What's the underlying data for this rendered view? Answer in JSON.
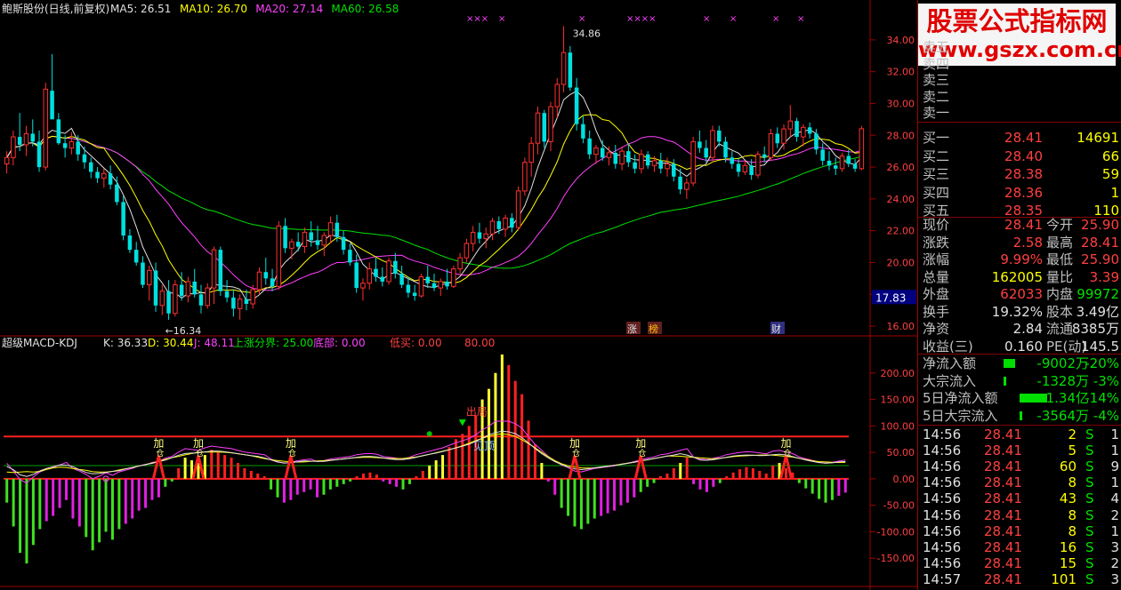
{
  "main_chart": {
    "title": "鲍斯股份(日线,前复权)",
    "legend": [
      {
        "label": "MA5: 26.51",
        "color": "#e0e0e0"
      },
      {
        "label": "MA10: 26.70",
        "color": "#ffff00"
      },
      {
        "label": "MA20: 27.14",
        "color": "#ff40ff"
      },
      {
        "label": "MA60: 26.58",
        "color": "#00e000"
      }
    ],
    "y_ticks": [
      "34.00",
      "32.00",
      "30.00",
      "28.00",
      "26.00",
      "24.00",
      "22.00",
      "20.00",
      "18.00",
      "16.00"
    ],
    "current_price_tag": "17.83",
    "high_label": "34.86",
    "low_label": "←16.34",
    "event_marks": [
      "涨",
      "榜",
      "财"
    ],
    "top_marks": [
      "×××",
      "×",
      "×",
      "××××",
      "×",
      "×",
      "×",
      "×"
    ]
  },
  "chart_data": [
    {
      "type": "candlestick",
      "title": "鲍斯股份(日线,前复权)",
      "ylim": [
        15.5,
        35.5
      ],
      "legend": [
        "MA5: 26.51",
        "MA10: 26.70",
        "MA20: 27.14",
        "MA60: 26.58"
      ],
      "annotations": [
        "34.86",
        "←16.34"
      ],
      "ohlc": [
        [
          26.2,
          27.0,
          25.6,
          26.6
        ],
        [
          26.6,
          28.3,
          26.1,
          27.9
        ],
        [
          27.9,
          29.4,
          27.0,
          27.4
        ],
        [
          27.4,
          28.6,
          26.7,
          28.1
        ],
        [
          28.1,
          29.0,
          27.3,
          27.6
        ],
        [
          27.6,
          28.3,
          25.7,
          26.0
        ],
        [
          26.0,
          31.3,
          25.8,
          30.9
        ],
        [
          30.8,
          33.1,
          29.6,
          29.0
        ],
        [
          29.0,
          29.4,
          27.4,
          27.5
        ],
        [
          27.5,
          28.0,
          26.6,
          27.2
        ],
        [
          27.2,
          28.2,
          26.8,
          27.6
        ],
        [
          27.6,
          28.0,
          26.4,
          26.8
        ],
        [
          26.8,
          27.3,
          25.9,
          26.3
        ],
        [
          26.3,
          26.6,
          25.3,
          25.7
        ],
        [
          25.7,
          26.0,
          25.0,
          25.3
        ],
        [
          25.3,
          25.9,
          24.7,
          25.6
        ],
        [
          25.6,
          26.1,
          24.6,
          24.9
        ],
        [
          24.9,
          25.4,
          23.6,
          23.8
        ],
        [
          23.8,
          24.2,
          21.4,
          21.7
        ],
        [
          21.7,
          22.1,
          20.6,
          20.8
        ],
        [
          20.8,
          21.3,
          19.8,
          20.0
        ],
        [
          20.0,
          20.4,
          18.4,
          18.6
        ],
        [
          18.6,
          19.8,
          17.6,
          19.5
        ],
        [
          19.5,
          20.0,
          16.9,
          17.3
        ],
        [
          17.3,
          18.6,
          16.7,
          18.2
        ],
        [
          18.2,
          18.9,
          16.4,
          16.8
        ],
        [
          16.8,
          18.9,
          16.6,
          18.6
        ],
        [
          18.6,
          19.4,
          17.6,
          17.9
        ],
        [
          17.9,
          19.1,
          17.5,
          18.8
        ],
        [
          18.8,
          19.6,
          17.8,
          18.0
        ],
        [
          18.0,
          18.6,
          16.8,
          17.3
        ],
        [
          17.3,
          18.7,
          17.1,
          18.4
        ],
        [
          18.4,
          21.0,
          17.4,
          20.8
        ],
        [
          20.8,
          21.0,
          17.9,
          18.2
        ],
        [
          18.2,
          18.9,
          17.5,
          17.8
        ],
        [
          17.8,
          18.3,
          16.6,
          17.1
        ],
        [
          17.1,
          18.0,
          16.4,
          17.7
        ],
        [
          17.7,
          18.3,
          17.0,
          17.4
        ],
        [
          17.4,
          18.6,
          17.1,
          18.3
        ],
        [
          18.3,
          19.7,
          18.0,
          19.4
        ],
        [
          19.4,
          20.3,
          18.6,
          19.0
        ],
        [
          19.0,
          19.6,
          18.2,
          18.5
        ],
        [
          18.5,
          22.6,
          18.3,
          22.3
        ],
        [
          22.3,
          22.8,
          20.6,
          20.9
        ],
        [
          20.9,
          21.5,
          20.2,
          21.3
        ],
        [
          21.3,
          21.9,
          20.7,
          21.0
        ],
        [
          21.0,
          22.2,
          20.6,
          21.9
        ],
        [
          21.9,
          22.6,
          21.0,
          21.4
        ],
        [
          21.4,
          22.3,
          20.8,
          21.1
        ],
        [
          21.1,
          21.9,
          20.4,
          21.7
        ],
        [
          21.7,
          22.9,
          21.2,
          22.5
        ],
        [
          22.5,
          23.0,
          21.3,
          21.6
        ],
        [
          21.6,
          22.0,
          20.5,
          20.8
        ],
        [
          20.8,
          21.2,
          19.8,
          20.0
        ],
        [
          20.0,
          20.5,
          18.1,
          18.4
        ],
        [
          18.4,
          19.0,
          17.6,
          18.7
        ],
        [
          18.7,
          20.0,
          18.3,
          19.6
        ],
        [
          19.6,
          20.3,
          18.8,
          19.1
        ],
        [
          19.1,
          19.7,
          18.5,
          18.8
        ],
        [
          18.8,
          20.3,
          18.6,
          20.1
        ],
        [
          20.1,
          20.6,
          19.0,
          19.3
        ],
        [
          19.3,
          19.8,
          18.4,
          18.6
        ],
        [
          18.6,
          19.1,
          17.8,
          18.1
        ],
        [
          18.1,
          18.6,
          17.6,
          17.9
        ],
        [
          17.9,
          19.3,
          17.8,
          19.1
        ],
        [
          19.1,
          19.8,
          18.4,
          18.7
        ],
        [
          18.7,
          19.3,
          18.2,
          18.4
        ],
        [
          18.4,
          19.0,
          17.9,
          18.8
        ],
        [
          18.8,
          19.6,
          18.3,
          18.5
        ],
        [
          18.5,
          19.8,
          18.4,
          19.6
        ],
        [
          19.6,
          20.6,
          19.2,
          20.3
        ],
        [
          20.3,
          21.5,
          20.0,
          21.2
        ],
        [
          21.2,
          22.3,
          20.7,
          21.9
        ],
        [
          21.9,
          22.5,
          21.2,
          21.5
        ],
        [
          21.5,
          22.2,
          20.9,
          21.8
        ],
        [
          21.8,
          22.8,
          21.4,
          22.6
        ],
        [
          22.6,
          22.9,
          21.8,
          22.1
        ],
        [
          22.1,
          23.0,
          21.6,
          22.8
        ],
        [
          22.8,
          23.1,
          21.9,
          22.2
        ],
        [
          22.2,
          24.8,
          22.0,
          24.5
        ],
        [
          24.5,
          26.6,
          24.2,
          26.3
        ],
        [
          26.3,
          27.9,
          25.4,
          27.5
        ],
        [
          27.5,
          29.8,
          26.8,
          29.4
        ],
        [
          29.4,
          29.6,
          27.2,
          27.6
        ],
        [
          27.6,
          30.1,
          27.0,
          29.8
        ],
        [
          29.8,
          31.6,
          29.1,
          31.2
        ],
        [
          31.2,
          34.86,
          30.7,
          33.2
        ],
        [
          33.2,
          33.6,
          30.8,
          31.0
        ],
        [
          31.0,
          31.6,
          28.3,
          28.7
        ],
        [
          28.7,
          29.2,
          27.5,
          27.8
        ],
        [
          27.8,
          28.3,
          26.5,
          26.8
        ],
        [
          26.8,
          27.4,
          26.2,
          27.2
        ],
        [
          27.2,
          27.7,
          26.4,
          26.6
        ],
        [
          26.6,
          27.3,
          26.1,
          26.9
        ],
        [
          26.9,
          27.4,
          25.9,
          26.2
        ],
        [
          26.2,
          27.3,
          25.8,
          27.0
        ],
        [
          27.0,
          27.5,
          26.0,
          26.3
        ],
        [
          26.3,
          26.8,
          25.6,
          25.9
        ],
        [
          25.9,
          27.1,
          25.6,
          26.8
        ],
        [
          26.8,
          27.0,
          25.9,
          26.1
        ],
        [
          26.1,
          26.7,
          25.7,
          26.4
        ],
        [
          26.4,
          26.9,
          25.6,
          25.9
        ],
        [
          25.9,
          26.6,
          25.4,
          26.2
        ],
        [
          26.2,
          26.5,
          25.1,
          25.4
        ],
        [
          25.4,
          25.9,
          24.3,
          24.6
        ],
        [
          24.6,
          25.3,
          24.0,
          25.0
        ],
        [
          25.0,
          27.9,
          24.8,
          27.6
        ],
        [
          27.6,
          28.3,
          26.9,
          27.2
        ],
        [
          27.2,
          27.7,
          26.3,
          26.6
        ],
        [
          26.6,
          28.6,
          26.3,
          28.3
        ],
        [
          28.3,
          28.6,
          27.3,
          27.6
        ],
        [
          27.6,
          27.9,
          26.3,
          26.6
        ],
        [
          26.6,
          27.0,
          25.9,
          26.2
        ],
        [
          26.2,
          26.6,
          25.4,
          25.7
        ],
        [
          25.7,
          26.4,
          25.5,
          26.1
        ],
        [
          26.1,
          26.5,
          25.2,
          25.5
        ],
        [
          25.5,
          27.0,
          25.3,
          26.8
        ],
        [
          26.8,
          27.3,
          26.3,
          26.6
        ],
        [
          26.6,
          28.4,
          26.4,
          28.1
        ],
        [
          28.1,
          28.5,
          27.2,
          27.5
        ],
        [
          27.5,
          28.7,
          27.1,
          28.4
        ],
        [
          28.4,
          29.9,
          27.9,
          28.9
        ],
        [
          28.9,
          29.1,
          27.6,
          27.9
        ],
        [
          27.9,
          28.7,
          27.3,
          28.5
        ],
        [
          28.5,
          28.8,
          27.8,
          28.1
        ],
        [
          28.1,
          28.4,
          26.8,
          27.1
        ],
        [
          27.1,
          27.5,
          26.1,
          26.4
        ],
        [
          26.4,
          27.0,
          25.8,
          26.1
        ],
        [
          26.1,
          26.6,
          25.5,
          25.9
        ],
        [
          25.9,
          26.9,
          25.7,
          26.7
        ],
        [
          26.7,
          27.1,
          26.0,
          26.2
        ],
        [
          26.2,
          26.5,
          25.7,
          25.9
        ],
        [
          25.9,
          28.6,
          25.8,
          28.41
        ]
      ]
    },
    {
      "type": "bar",
      "title": "超级MACD-KDJ",
      "ylim": [
        -200,
        250
      ],
      "legend": [
        "K: 36.33",
        "D: 30.44",
        "J: 48.11",
        "上涨分界: 25.00",
        "底部: 0.00",
        "低买: 0.00",
        "80.00"
      ],
      "annotations": [
        "加仓",
        "加仓",
        "加仓",
        "加仓",
        "加仓",
        "加仓",
        "加仓",
        "出局",
        "见顶"
      ],
      "reference_lines": [
        80,
        0
      ],
      "values": [
        -45,
        -90,
        -140,
        -160,
        -125,
        -95,
        -80,
        -70,
        -55,
        -40,
        -75,
        -90,
        -110,
        -135,
        -120,
        -100,
        -115,
        -95,
        -85,
        -75,
        -60,
        -55,
        -40,
        -35,
        -15,
        -5,
        20,
        40,
        35,
        30,
        45,
        55,
        50,
        45,
        40,
        30,
        20,
        15,
        10,
        5,
        -20,
        -35,
        -45,
        -40,
        -30,
        -25,
        -20,
        -35,
        -30,
        -20,
        -15,
        -10,
        -5,
        5,
        10,
        12,
        8,
        -5,
        -10,
        -15,
        -20,
        -10,
        5,
        15,
        25,
        35,
        45,
        60,
        75,
        85,
        100,
        120,
        150,
        170,
        200,
        235,
        215,
        185,
        160,
        110,
        65,
        30,
        -5,
        -30,
        -55,
        -70,
        -90,
        -95,
        -85,
        -75,
        -70,
        -65,
        -60,
        -50,
        -45,
        -35,
        -25,
        -15,
        -8,
        5,
        10,
        20,
        30,
        40,
        -10,
        -20,
        -25,
        -15,
        -8,
        5,
        12,
        18,
        22,
        20,
        15,
        10,
        25,
        30,
        20,
        12,
        -8,
        -18,
        -28,
        -38,
        -45,
        -40,
        -32,
        -26
      ]
    }
  ],
  "quote_panel": {
    "watermark": [
      "股票公式指标网",
      "www.gszx.com.cn"
    ],
    "sell_rows": [
      {
        "label": "卖五"
      },
      {
        "label": "卖四"
      },
      {
        "label": "卖三"
      },
      {
        "label": "卖二"
      },
      {
        "label": "卖一"
      }
    ],
    "buy_rows": [
      {
        "label": "买一",
        "price": "28.41",
        "vol": "14691"
      },
      {
        "label": "买二",
        "price": "28.40",
        "vol": "66"
      },
      {
        "label": "买三",
        "price": "28.38",
        "vol": "59"
      },
      {
        "label": "买四",
        "price": "28.36",
        "vol": "1"
      },
      {
        "label": "买五",
        "price": "28.35",
        "vol": "110"
      }
    ],
    "stats": [
      {
        "l1": "现价",
        "v1": "28.41",
        "l2": "今开",
        "v2": "25.90",
        "c1": "red",
        "c2": "red"
      },
      {
        "l1": "涨跌",
        "v1": "2.58",
        "l2": "最高",
        "v2": "28.41",
        "c1": "red",
        "c2": "red"
      },
      {
        "l1": "涨幅",
        "v1": "9.99%",
        "l2": "最低",
        "v2": "25.90",
        "c1": "red",
        "c2": "red"
      },
      {
        "l1": "总量",
        "v1": "162005",
        "l2": "量比",
        "v2": "3.39",
        "c1": "yel",
        "c2": "red"
      },
      {
        "l1": "外盘",
        "v1": "62033",
        "l2": "内盘",
        "v2": "99972",
        "c1": "red",
        "c2": "grn"
      },
      {
        "l1": "换手",
        "v1": "19.32%",
        "l2": "股本",
        "v2": "3.49亿",
        "c1": "wht",
        "c2": "wht"
      },
      {
        "l1": "净资",
        "v1": "2.84",
        "l2": "流通",
        "v2": "8385万",
        "c1": "wht",
        "c2": "wht"
      },
      {
        "l1": "收益(三)",
        "v1": "0.160",
        "l2": "PE(动)",
        "v2": "145.5",
        "c1": "wht",
        "c2": "wht"
      }
    ],
    "flows": [
      {
        "label": "净流入额",
        "value": "-9002万",
        "pct": "-20%",
        "bar": 0.3
      },
      {
        "label": "大宗流入",
        "value": "-1328万",
        "pct": "-3%",
        "bar": 0.03
      },
      {
        "label": "5日净流入额",
        "value": "-1.34亿",
        "pct": "-14%",
        "bar": 0.7
      },
      {
        "label": "5日大宗流入",
        "value": "-3564万",
        "pct": "-4%",
        "bar": 0.07
      }
    ],
    "ticks": [
      {
        "time": "14:56",
        "price": "28.41",
        "vol": "2",
        "side": "S",
        "n": "1"
      },
      {
        "time": "14:56",
        "price": "28.41",
        "vol": "5",
        "side": "S",
        "n": "1"
      },
      {
        "time": "14:56",
        "price": "28.41",
        "vol": "60",
        "side": "S",
        "n": "9"
      },
      {
        "time": "14:56",
        "price": "28.41",
        "vol": "8",
        "side": "S",
        "n": "1"
      },
      {
        "time": "14:56",
        "price": "28.41",
        "vol": "43",
        "side": "S",
        "n": "4"
      },
      {
        "time": "14:56",
        "price": "28.41",
        "vol": "8",
        "side": "S",
        "n": "2"
      },
      {
        "time": "14:56",
        "price": "28.41",
        "vol": "8",
        "side": "S",
        "n": "1"
      },
      {
        "time": "14:56",
        "price": "28.41",
        "vol": "16",
        "side": "S",
        "n": "3"
      },
      {
        "time": "14:56",
        "price": "28.41",
        "vol": "15",
        "side": "S",
        "n": "2"
      },
      {
        "time": "14:57",
        "price": "28.41",
        "vol": "101",
        "side": "S",
        "n": "3"
      }
    ]
  },
  "indicator": {
    "title": "超级MACD-KDJ",
    "legend": [
      {
        "label": "K: 36.33",
        "color": "#e0e0e0"
      },
      {
        "label": "D: 30.44",
        "color": "#ffff00"
      },
      {
        "label": "J: 48.11",
        "color": "#ff40ff"
      },
      {
        "label": "上涨分界: 25.00",
        "color": "#00e000"
      },
      {
        "label": "底部: 0.00",
        "color": "#ff40ff"
      },
      {
        "label": "低买: 0.00",
        "color": "#ff4040"
      },
      {
        "label": "80.00",
        "color": "#ff4040"
      }
    ],
    "y_ticks": [
      "200.00",
      "150.00",
      "100.00",
      "50.00",
      "0.00",
      "-50.00",
      "-100.00",
      "-150.00"
    ],
    "signal_buy": "加仓",
    "signal_out": "出局",
    "signal_top": "见顶"
  },
  "colors": {
    "up": "#ff3030",
    "down": "#00e0e0",
    "ma5": "#e0e0e0",
    "ma10": "#ffff00",
    "ma20": "#ff40ff",
    "ma60": "#00e000",
    "border": "#a00000"
  }
}
